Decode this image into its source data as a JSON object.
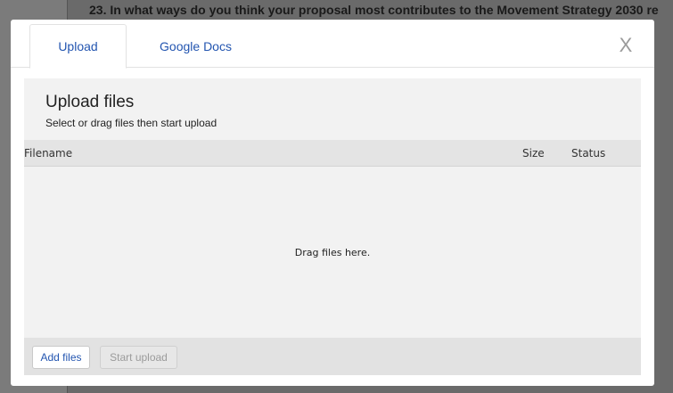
{
  "background": {
    "question_text": "23. In what ways do you think your proposal most contributes to the Movement Strategy 2030 re"
  },
  "modal": {
    "tabs": [
      {
        "label": "Upload",
        "active": true
      },
      {
        "label": "Google Docs",
        "active": false
      }
    ],
    "close_label": "X",
    "panel": {
      "title": "Upload files",
      "subtitle": "Select or drag files then start upload"
    },
    "table": {
      "columns": [
        "Filename",
        "Size",
        "Status"
      ],
      "rows": []
    },
    "drop_text": "Drag files here.",
    "buttons": {
      "add_files": "Add files",
      "start_upload": "Start upload"
    }
  },
  "colors": {
    "accent": "#2355b0",
    "overlay": "#6b6b6b",
    "panel_bg": "#f2f2f2"
  }
}
